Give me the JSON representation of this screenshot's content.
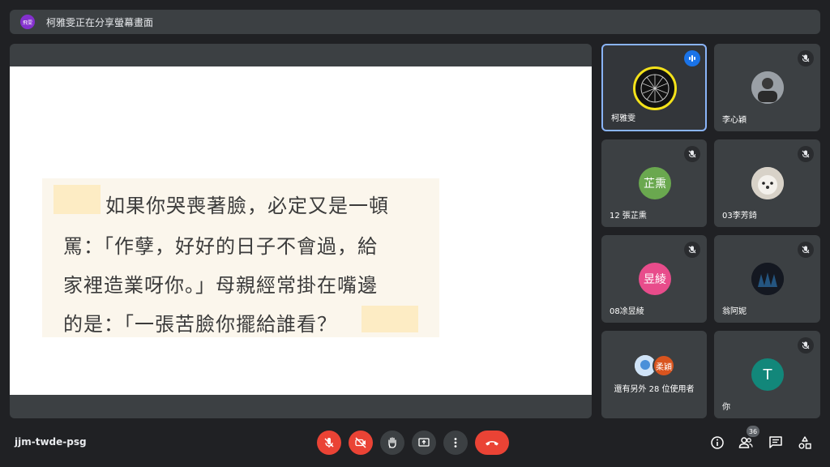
{
  "banner": {
    "badge": "飛雯",
    "text": "柯雅雯正在分享螢幕畫面"
  },
  "slide": {
    "lines": [
      "如果你哭喪著臉，必定又是一頓",
      "罵：「作孽，好好的日子不會過，給",
      "家裡造業呀你。」母親經常掛在嘴邊",
      "的是：「一張苦臉你擺給誰看？"
    ]
  },
  "tiles": [
    {
      "name": "柯雅雯"
    },
    {
      "name": "李心穎"
    },
    {
      "name": "12 張芷熏",
      "avatar_text": "芷熏",
      "avatar_color": "#6aa84f"
    },
    {
      "name": "03李芳錡"
    },
    {
      "name": "08凃昱綾",
      "avatar_text": "昱綾",
      "avatar_color": "#e84c8b"
    },
    {
      "name": "翁阿妮"
    },
    {
      "name": "還有另外 28 位使用者",
      "avatar_text": "柔穎",
      "avatar_color": "#d9541e"
    },
    {
      "name": "你",
      "avatar_text": "T",
      "avatar_color": "#12877a"
    }
  ],
  "bottom": {
    "meeting_code": "jjm-twde-psg",
    "participant_count": "36"
  },
  "colors": {
    "accent": "#8ab4f8",
    "danger": "#ea4335",
    "surface": "#3c4043",
    "background": "#202124"
  }
}
